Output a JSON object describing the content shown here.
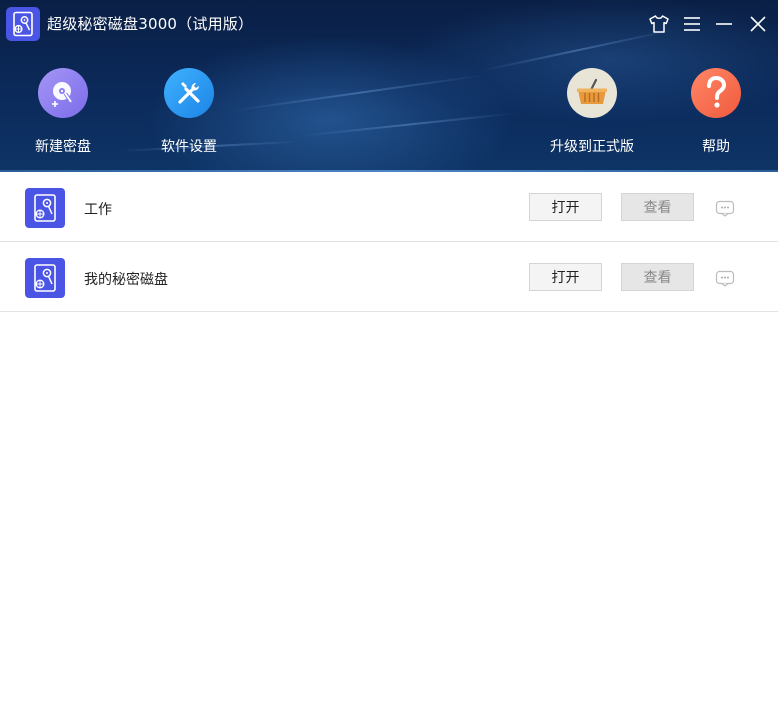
{
  "window": {
    "title": "超级秘密磁盘3000（试用版）",
    "icon": "app-disk-logo",
    "controls": {
      "skin": "shirt-icon",
      "menu": "menu-icon",
      "minimize": "minimize-icon",
      "close": "close-icon"
    }
  },
  "toolbar": {
    "items": [
      {
        "label": "新建密盘",
        "icon": "new-disk-icon",
        "color": "#8a7ef0"
      },
      {
        "label": "软件设置",
        "icon": "settings-tools-icon",
        "color": "#2f9bf2"
      },
      {
        "label": "升级到正式版",
        "icon": "basket-icon",
        "color": "#e8e4d6"
      },
      {
        "label": "帮助",
        "icon": "question-icon",
        "color": "#f46a4e"
      }
    ]
  },
  "disks": [
    {
      "name": "工作",
      "open_label": "打开",
      "view_label": "查看"
    },
    {
      "name": "我的秘密磁盘",
      "open_label": "打开",
      "view_label": "查看"
    }
  ],
  "colors": {
    "header_bg": "#0b2a5b",
    "disk_icon_bg": "#4a55e6",
    "view_disabled_text": "#888888"
  }
}
